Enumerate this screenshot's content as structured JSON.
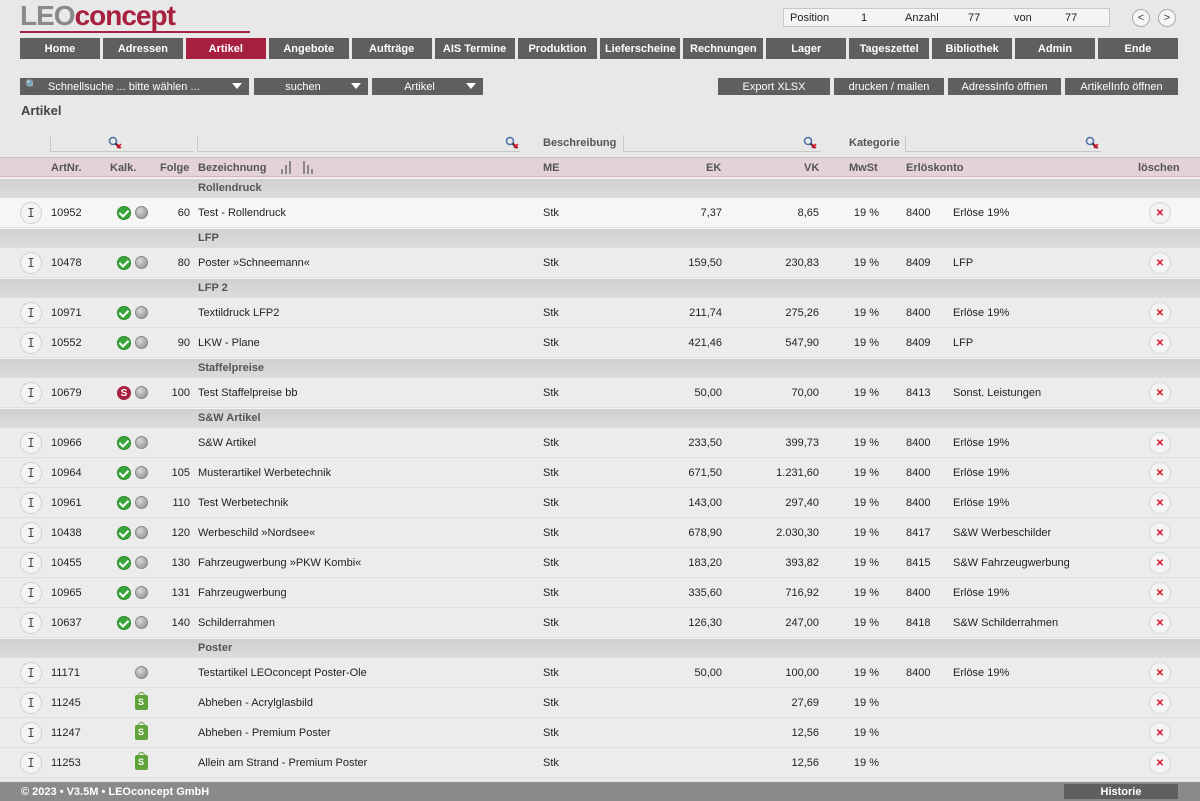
{
  "brand": {
    "leo": "LEO",
    "concept": "concept"
  },
  "position": {
    "label": "Position",
    "value": "1",
    "count_label": "Anzahl",
    "count": "77",
    "of_label": "von",
    "total": "77",
    "prev": "<",
    "next": ">"
  },
  "nav": [
    "Home",
    "Adressen",
    "Artikel",
    "Angebote",
    "Aufträge",
    "AIS Termine",
    "Produktion",
    "Lieferscheine",
    "Rechnungen",
    "Lager",
    "Tageszettel",
    "Bibliothek",
    "Admin",
    "Ende"
  ],
  "nav_active": "Artikel",
  "toolbar": {
    "quicksearch": "Schnellsuche ... bitte wählen ...",
    "search": "suchen",
    "scope": "Artikel",
    "export": "Export XLSX",
    "print": "drucken / mailen",
    "addressinfo": "AdressInfo öffnen",
    "articleinfo": "ArtikelInfo öffnen"
  },
  "page_title": "Artikel",
  "filters": {
    "description": "Beschreibung",
    "category": "Kategorie"
  },
  "columns": {
    "artnr": "ArtNr.",
    "kalk": "Kalk.",
    "folge": "Folge",
    "bezeichnung": "Bezeichnung",
    "me": "ME",
    "ek": "EK",
    "vk": "VK",
    "mwst": "MwSt",
    "erloeskonto": "Erlöskonto",
    "loeschen": "löschen"
  },
  "groups": [
    {
      "name": "Rollendruck",
      "rows": [
        {
          "artnr": "10952",
          "kalk": "ok",
          "folge": "60",
          "bez": "Test - Rollendruck",
          "me": "Stk",
          "ek": "7,37",
          "vk": "8,65",
          "mwst": "19 %",
          "konto": "8400",
          "konto_name": "Erlöse 19%"
        }
      ]
    },
    {
      "name": "LFP",
      "rows": [
        {
          "artnr": "10478",
          "kalk": "ok",
          "folge": "80",
          "bez": "Poster »Schneemann«",
          "me": "Stk",
          "ek": "159,50",
          "vk": "230,83",
          "mwst": "19 %",
          "konto": "8409",
          "konto_name": "LFP"
        }
      ]
    },
    {
      "name": "LFP 2",
      "rows": [
        {
          "artnr": "10971",
          "kalk": "ok",
          "folge": "",
          "bez": "Textildruck LFP2",
          "me": "Stk",
          "ek": "211,74",
          "vk": "275,26",
          "mwst": "19 %",
          "konto": "8400",
          "konto_name": "Erlöse 19%"
        },
        {
          "artnr": "10552",
          "kalk": "ok",
          "folge": "90",
          "bez": "LKW - Plane",
          "me": "Stk",
          "ek": "421,46",
          "vk": "547,90",
          "mwst": "19 %",
          "konto": "8409",
          "konto_name": "LFP"
        }
      ]
    },
    {
      "name": "Staffelpreise",
      "rows": [
        {
          "artnr": "10679",
          "kalk": "s",
          "folge": "100",
          "bez": "Test Staffelpreise bb",
          "me": "Stk",
          "ek": "50,00",
          "vk": "70,00",
          "mwst": "19 %",
          "konto": "8413",
          "konto_name": "Sonst. Leistungen"
        }
      ]
    },
    {
      "name": "S&W Artikel",
      "rows": [
        {
          "artnr": "10966",
          "kalk": "ok",
          "folge": "",
          "bez": "S&W Artikel",
          "me": "Stk",
          "ek": "233,50",
          "vk": "399,73",
          "mwst": "19 %",
          "konto": "8400",
          "konto_name": "Erlöse 19%"
        },
        {
          "artnr": "10964",
          "kalk": "ok",
          "folge": "105",
          "bez": "Musterartikel Werbetechnik",
          "me": "Stk",
          "ek": "671,50",
          "vk": "1.231,60",
          "mwst": "19 %",
          "konto": "8400",
          "konto_name": "Erlöse 19%"
        },
        {
          "artnr": "10961",
          "kalk": "ok",
          "folge": "110",
          "bez": "Test Werbetechnik",
          "me": "Stk",
          "ek": "143,00",
          "vk": "297,40",
          "mwst": "19 %",
          "konto": "8400",
          "konto_name": "Erlöse 19%"
        },
        {
          "artnr": "10438",
          "kalk": "ok",
          "folge": "120",
          "bez": "Werbeschild »Nordsee«",
          "me": "Stk",
          "ek": "678,90",
          "vk": "2.030,30",
          "mwst": "19 %",
          "konto": "8417",
          "konto_name": "S&W Werbeschilder"
        },
        {
          "artnr": "10455",
          "kalk": "ok",
          "folge": "130",
          "bez": "Fahrzeugwerbung »PKW Kombi«",
          "me": "Stk",
          "ek": "183,20",
          "vk": "393,82",
          "mwst": "19 %",
          "konto": "8415",
          "konto_name": "S&W Fahrzeugwerbung"
        },
        {
          "artnr": "10965",
          "kalk": "ok",
          "folge": "131",
          "bez": "Fahrzeugwerbung",
          "me": "Stk",
          "ek": "335,60",
          "vk": "716,92",
          "mwst": "19 %",
          "konto": "8400",
          "konto_name": "Erlöse 19%"
        },
        {
          "artnr": "10637",
          "kalk": "ok",
          "folge": "140",
          "bez": "Schilderrahmen",
          "me": "Stk",
          "ek": "126,30",
          "vk": "247,00",
          "mwst": "19 %",
          "konto": "8418",
          "konto_name": "S&W Schilderrahmen"
        }
      ]
    },
    {
      "name": "Poster",
      "rows": [
        {
          "artnr": "11171",
          "kalk": "none",
          "folge": "",
          "bez": "Testartikel LEOconcept Poster-Ole",
          "me": "Stk",
          "ek": "50,00",
          "vk": "100,00",
          "mwst": "19 %",
          "konto": "8400",
          "konto_name": "Erlöse 19%"
        },
        {
          "artnr": "11245",
          "kalk": "shop",
          "folge": "",
          "bez": "Abheben - Acrylglasbild",
          "me": "Stk",
          "ek": "",
          "vk": "27,69",
          "mwst": "19 %",
          "konto": "",
          "konto_name": ""
        },
        {
          "artnr": "11247",
          "kalk": "shop",
          "folge": "",
          "bez": "Abheben - Premium Poster",
          "me": "Stk",
          "ek": "",
          "vk": "12,56",
          "mwst": "19 %",
          "konto": "",
          "konto_name": ""
        },
        {
          "artnr": "11253",
          "kalk": "shop",
          "folge": "",
          "bez": "Allein am Strand - Premium Poster",
          "me": "Stk",
          "ek": "",
          "vk": "12,56",
          "mwst": "19 %",
          "konto": "",
          "konto_name": ""
        }
      ]
    }
  ],
  "footer": {
    "copyright": "© 2023 • V3.5M • LEOconcept GmbH",
    "history": "Historie"
  },
  "colors": {
    "accent": "#a8203f",
    "nav": "#5f5f5f",
    "ok": "#3aa63a",
    "delete": "#d8102a"
  }
}
